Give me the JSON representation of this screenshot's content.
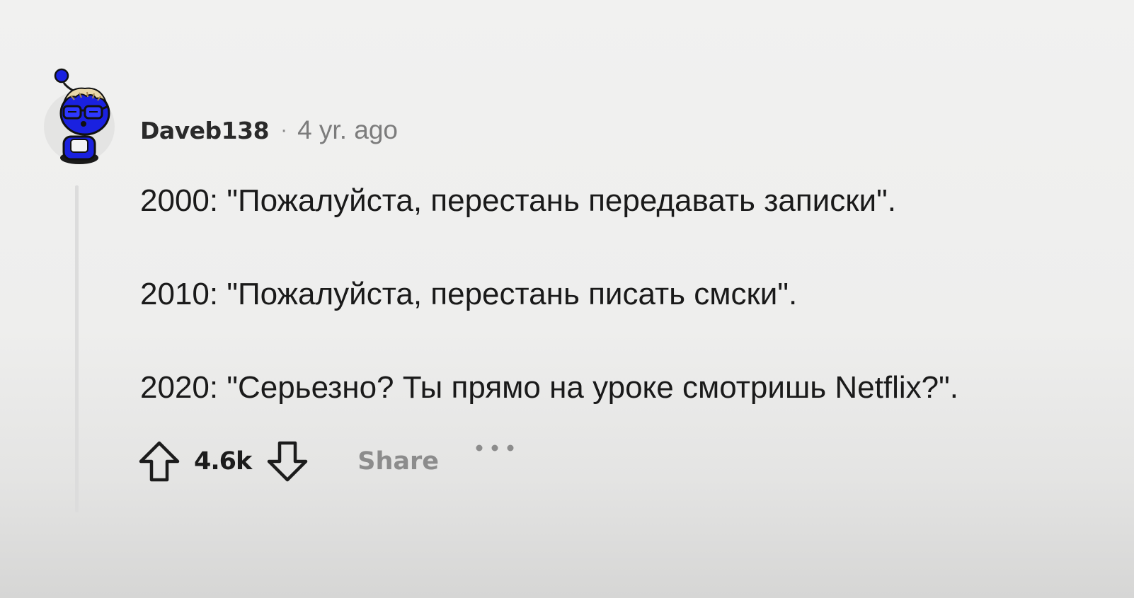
{
  "comment": {
    "author": "Daveb138",
    "separator": "·",
    "time_ago": "4 yr. ago",
    "lines": [
      "2000: \"Пожалуйста, перестань передавать записки\".",
      "2010: \"Пожалуйста, перестань писать смски\".",
      "2020: \"Серьезно? Ты прямо на уроке смотришь Netflix?\"."
    ],
    "score": "4.6k",
    "share_label": "Share",
    "more_label": "···"
  },
  "icons": {
    "avatar": "snoo-avatar-icon",
    "upvote": "arrow-up-icon",
    "downvote": "arrow-down-icon",
    "more": "more-horizontal-icon"
  },
  "colors": {
    "avatar_blue": "#1a21e0",
    "text": "#1c1c1c",
    "muted": "#8c8c8c"
  }
}
